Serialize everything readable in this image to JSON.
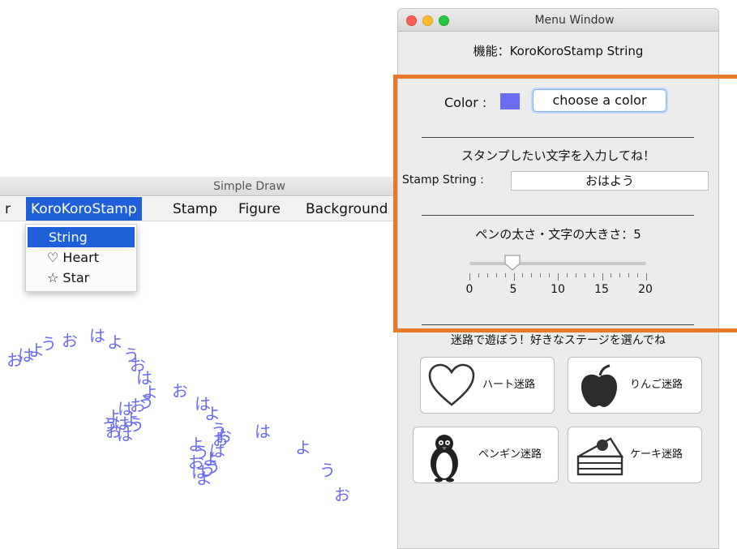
{
  "draw_window": {
    "title": "Simple Draw",
    "menus": [
      "r",
      "KoroKoroStamp",
      "Stamp",
      "Figure",
      "Background"
    ],
    "dropdown": [
      "String",
      "♡ Heart",
      "☆ Star"
    ],
    "stamp_text": "おはよう"
  },
  "menu_window": {
    "title": "Menu Window",
    "function_label": "機能：KoroKoroStamp String",
    "color_label": "Color :",
    "color_value": "#6a6cf2",
    "color_button": "choose a color",
    "divider": "____________________________________",
    "prompt": "スタンプしたい文字を入力してね！",
    "stamp_label": "Stamp String :",
    "stamp_value": "おはよう",
    "size_label": "ペンの太さ・文字の大きさ：5",
    "slider": {
      "min": 0,
      "max": 20,
      "value": 5,
      "ticks": [
        "0",
        "5",
        "10",
        "15",
        "20"
      ]
    },
    "maze_prompt": "迷路で遊ぼう！好きなステージを選んでね",
    "maze_buttons": [
      {
        "icon": "heart-icon",
        "label": "ハート迷路"
      },
      {
        "icon": "apple-icon",
        "label": "りんご迷路"
      },
      {
        "icon": "penguin-icon",
        "label": "ペンギン迷路"
      },
      {
        "icon": "cake-icon",
        "label": "ケーキ迷路"
      }
    ]
  },
  "colors": {
    "stamp": "#6a6cf2",
    "highlight": "#e8782a",
    "menu_active": "#1f5fd8"
  }
}
